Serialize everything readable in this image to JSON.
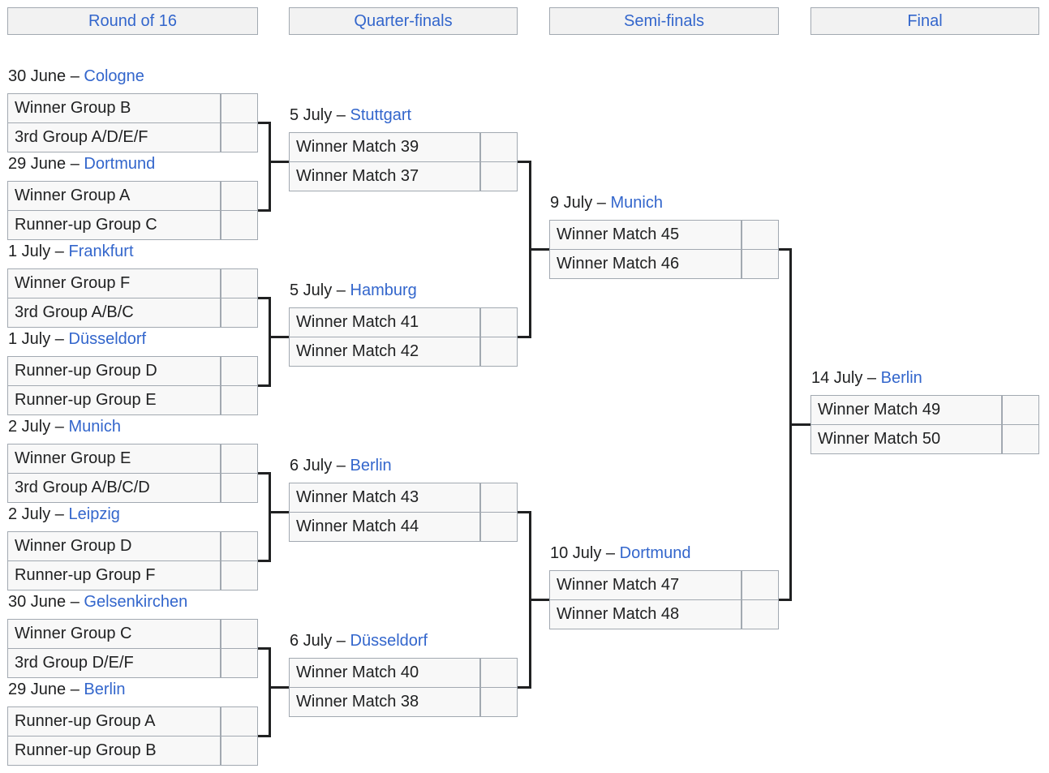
{
  "rounds": [
    {
      "label": "Round of 16"
    },
    {
      "label": "Quarter-finals"
    },
    {
      "label": "Semi-finals"
    },
    {
      "label": "Final"
    }
  ],
  "separator": " – ",
  "round_of_16": [
    {
      "date": "30 June",
      "venue": "Cologne",
      "teams": [
        "Winner Group B",
        "3rd Group A/D/E/F"
      ],
      "scores": [
        "",
        ""
      ]
    },
    {
      "date": "29 June",
      "venue": "Dortmund",
      "teams": [
        "Winner Group A",
        "Runner-up Group C"
      ],
      "scores": [
        "",
        ""
      ]
    },
    {
      "date": "1 July",
      "venue": "Frankfurt",
      "teams": [
        "Winner Group F",
        "3rd Group A/B/C"
      ],
      "scores": [
        "",
        ""
      ]
    },
    {
      "date": "1 July",
      "venue": "Düsseldorf",
      "teams": [
        "Runner-up Group D",
        "Runner-up Group E"
      ],
      "scores": [
        "",
        ""
      ]
    },
    {
      "date": "2 July",
      "venue": "Munich",
      "teams": [
        "Winner Group E",
        "3rd Group A/B/C/D"
      ],
      "scores": [
        "",
        ""
      ]
    },
    {
      "date": "2 July",
      "venue": "Leipzig",
      "teams": [
        "Winner Group D",
        "Runner-up Group F"
      ],
      "scores": [
        "",
        ""
      ]
    },
    {
      "date": "30 June",
      "venue": "Gelsenkirchen",
      "teams": [
        "Winner Group C",
        "3rd Group D/E/F"
      ],
      "scores": [
        "",
        ""
      ]
    },
    {
      "date": "29 June",
      "venue": "Berlin",
      "teams": [
        "Runner-up Group A",
        "Runner-up Group B"
      ],
      "scores": [
        "",
        ""
      ]
    }
  ],
  "quarter_finals": [
    {
      "date": "5 July",
      "venue": "Stuttgart",
      "teams": [
        "Winner Match 39",
        "Winner Match 37"
      ],
      "scores": [
        "",
        ""
      ]
    },
    {
      "date": "5 July",
      "venue": "Hamburg",
      "teams": [
        "Winner Match 41",
        "Winner Match 42"
      ],
      "scores": [
        "",
        ""
      ]
    },
    {
      "date": "6 July",
      "venue": "Berlin",
      "teams": [
        "Winner Match 43",
        "Winner Match 44"
      ],
      "scores": [
        "",
        ""
      ]
    },
    {
      "date": "6 July",
      "venue": "Düsseldorf",
      "teams": [
        "Winner Match 40",
        "Winner Match 38"
      ],
      "scores": [
        "",
        ""
      ]
    }
  ],
  "semi_finals": [
    {
      "date": "9 July",
      "venue": "Munich",
      "teams": [
        "Winner Match 45",
        "Winner Match 46"
      ],
      "scores": [
        "",
        ""
      ]
    },
    {
      "date": "10 July",
      "venue": "Dortmund",
      "teams": [
        "Winner Match 47",
        "Winner Match 48"
      ],
      "scores": [
        "",
        ""
      ]
    }
  ],
  "final": [
    {
      "date": "14 July",
      "venue": "Berlin",
      "teams": [
        "Winner Match 49",
        "Winner Match 50"
      ],
      "scores": [
        "",
        ""
      ]
    }
  ]
}
